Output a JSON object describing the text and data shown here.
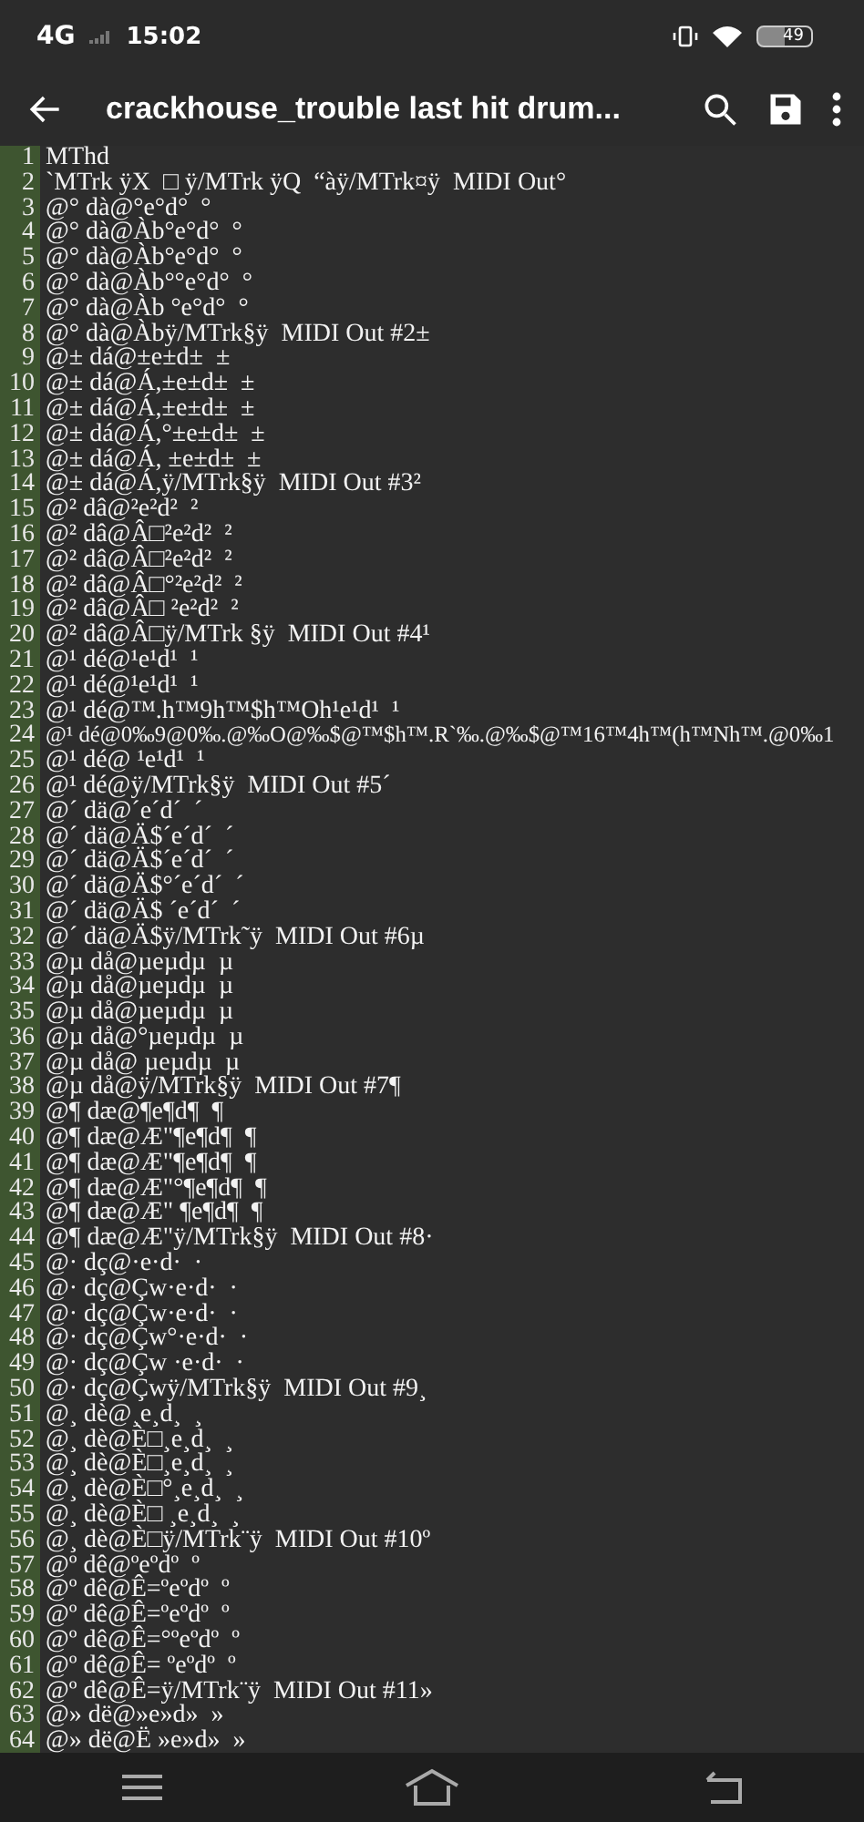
{
  "status_bar": {
    "network": "4G",
    "time": "15:02",
    "battery": "49"
  },
  "toolbar": {
    "title": "crackhouse_trouble last hit drum..."
  },
  "editor": {
    "lines": [
      {
        "number": "1",
        "text": "MThd"
      },
      {
        "number": "2",
        "text": "`MTrk ÿX  □ ÿ/MTrk ÿQ  “àÿ/MTrk¤ÿ  MIDI Out°"
      },
      {
        "number": "3",
        "text": "@° dà@°e°d°  °"
      },
      {
        "number": "4",
        "text": "@° dà@Àb°e°d°  °"
      },
      {
        "number": "5",
        "text": "@° dà@Àb°e°d°  °"
      },
      {
        "number": "6",
        "text": "@° dà@Àb°°e°d°  °"
      },
      {
        "number": "7",
        "text": "@° dà@Àb °e°d°  °"
      },
      {
        "number": "8",
        "text": "@° dà@Àbÿ/MTrk§ÿ  MIDI Out #2±"
      },
      {
        "number": "9",
        "text": "@± dá@±e±d±  ±"
      },
      {
        "number": "10",
        "text": "@± dá@Á,±e±d±  ±"
      },
      {
        "number": "11",
        "text": "@± dá@Á,±e±d±  ±"
      },
      {
        "number": "12",
        "text": "@± dá@Á,°±e±d±  ±"
      },
      {
        "number": "13",
        "text": "@± dá@Á, ±e±d±  ±"
      },
      {
        "number": "14",
        "text": "@± dá@Á,ÿ/MTrk§ÿ  MIDI Out #3²"
      },
      {
        "number": "15",
        "text": "@² dâ@²e²d²  ²"
      },
      {
        "number": "16",
        "text": "@² dâ@Â□²e²d²  ²"
      },
      {
        "number": "17",
        "text": "@² dâ@Â□²e²d²  ²"
      },
      {
        "number": "18",
        "text": "@² dâ@Â□°²e²d²  ²"
      },
      {
        "number": "19",
        "text": "@² dâ@Â□ ²e²d²  ²"
      },
      {
        "number": "20",
        "text": "@² dâ@Â□ÿ/MTrk §ÿ  MIDI Out #4¹"
      },
      {
        "number": "21",
        "text": "@¹ dé@¹e¹d¹  ¹"
      },
      {
        "number": "22",
        "text": "@¹ dé@¹e¹d¹  ¹"
      },
      {
        "number": "23",
        "text": "@¹ dé@™.h™9h™$h™Oh¹e¹d¹  ¹"
      },
      {
        "number": "24",
        "text": "@¹ dé@0‰9@0‰.@‰O@‰$@™$h™.R`‰.@‰$@™16™4h™(h™Nh™.@0‰1"
      },
      {
        "number": "25",
        "text": "@¹ dé@ ¹e¹d¹  ¹"
      },
      {
        "number": "26",
        "text": "@¹ dé@ÿ/MTrk§ÿ  MIDI Out #5´"
      },
      {
        "number": "27",
        "text": "@´ dä@´e´d´  ´"
      },
      {
        "number": "28",
        "text": "@´ dä@Ä$´e´d´  ´"
      },
      {
        "number": "29",
        "text": "@´ dä@Ä$´e´d´  ´"
      },
      {
        "number": "30",
        "text": "@´ dä@Ä$°´e´d´  ´"
      },
      {
        "number": "31",
        "text": "@´ dä@Ä$ ´e´d´  ´"
      },
      {
        "number": "32",
        "text": "@´ dä@Ä$ÿ/MTrk˜ÿ  MIDI Out #6µ"
      },
      {
        "number": "33",
        "text": "@µ då@µeµdµ  µ"
      },
      {
        "number": "34",
        "text": "@µ då@µeµdµ  µ"
      },
      {
        "number": "35",
        "text": "@µ då@µeµdµ  µ"
      },
      {
        "number": "36",
        "text": "@µ då@°µeµdµ  µ"
      },
      {
        "number": "37",
        "text": "@µ då@ µeµdµ  µ"
      },
      {
        "number": "38",
        "text": "@µ då@ÿ/MTrk§ÿ  MIDI Out #7¶"
      },
      {
        "number": "39",
        "text": "@¶ dæ@¶e¶d¶  ¶"
      },
      {
        "number": "40",
        "text": "@¶ dæ@Æ\"¶e¶d¶  ¶"
      },
      {
        "number": "41",
        "text": "@¶ dæ@Æ\"¶e¶d¶  ¶"
      },
      {
        "number": "42",
        "text": "@¶ dæ@Æ\"°¶e¶d¶  ¶"
      },
      {
        "number": "43",
        "text": "@¶ dæ@Æ\" ¶e¶d¶  ¶"
      },
      {
        "number": "44",
        "text": "@¶ dæ@Æ\"ÿ/MTrk§ÿ  MIDI Out #8·"
      },
      {
        "number": "45",
        "text": "@· dç@·e·d·  ·"
      },
      {
        "number": "46",
        "text": "@· dç@Çw·e·d·  ·"
      },
      {
        "number": "47",
        "text": "@· dç@Çw·e·d·  ·"
      },
      {
        "number": "48",
        "text": "@· dç@Çw°·e·d·  ·"
      },
      {
        "number": "49",
        "text": "@· dç@Çw ·e·d·  ·"
      },
      {
        "number": "50",
        "text": "@· dç@Çwÿ/MTrk§ÿ  MIDI Out #9¸"
      },
      {
        "number": "51",
        "text": "@¸ dè@¸e¸d¸  ¸"
      },
      {
        "number": "52",
        "text": "@¸ dè@È□¸e¸d¸  ¸"
      },
      {
        "number": "53",
        "text": "@¸ dè@È□¸e¸d¸  ¸"
      },
      {
        "number": "54",
        "text": "@¸ dè@È□°¸e¸d¸  ¸"
      },
      {
        "number": "55",
        "text": "@¸ dè@È□ ¸e¸d¸  ¸"
      },
      {
        "number": "56",
        "text": "@¸ dè@È□ÿ/MTrk¨ÿ  MIDI Out #10º"
      },
      {
        "number": "57",
        "text": "@º dê@ºeºdº  º"
      },
      {
        "number": "58",
        "text": "@º dê@Ê=ºeºdº  º"
      },
      {
        "number": "59",
        "text": "@º dê@Ê=ºeºdº  º"
      },
      {
        "number": "60",
        "text": "@º dê@Ê=°ºeºdº  º"
      },
      {
        "number": "61",
        "text": "@º dê@Ê= ºeºdº  º"
      },
      {
        "number": "62",
        "text": "@º dê@Ê=ÿ/MTrk¨ÿ  MIDI Out #11»"
      },
      {
        "number": "63",
        "text": "@» dë@»e»d»  »"
      },
      {
        "number": "64",
        "text": "@» dë@Ë »e»d»  »"
      }
    ]
  }
}
